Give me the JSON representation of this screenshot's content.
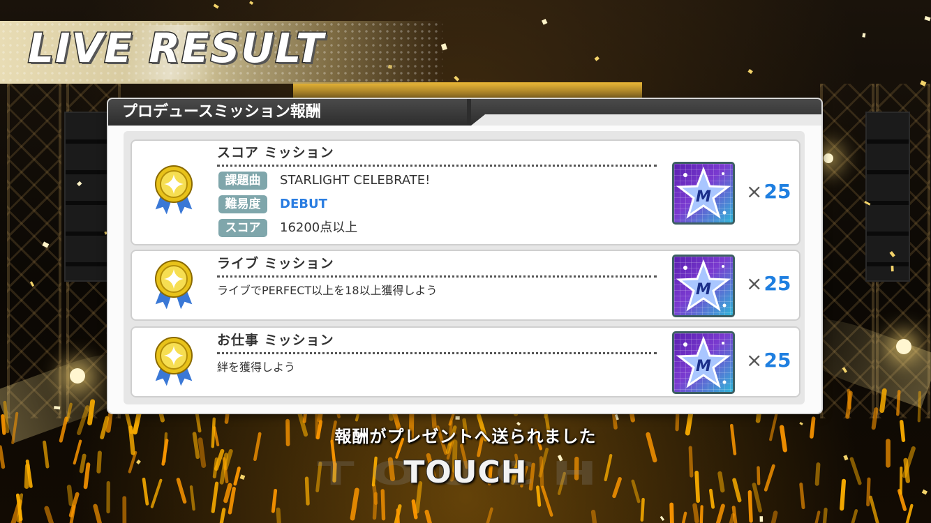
{
  "header": {
    "title": "LIVE RESULT"
  },
  "panel": {
    "title": "プロデュースミッション報酬"
  },
  "missions": [
    {
      "title": "スコア ミッション",
      "details": [
        {
          "tag": "課題曲",
          "value": "STARLIGHT CELEBRATE!"
        },
        {
          "tag": "難易度",
          "value": "DEBUT"
        },
        {
          "tag": "スコア",
          "value": "16200点以上"
        }
      ],
      "reward_icon": "star-m-icon",
      "reward_x": "×",
      "reward_qty": "25"
    },
    {
      "title": "ライブ ミッション",
      "description": "ライブでPERFECT以上を18以上獲得しよう",
      "reward_icon": "star-m-icon",
      "reward_x": "×",
      "reward_qty": "25"
    },
    {
      "title": "お仕事 ミッション",
      "description": "絆を獲得しよう",
      "reward_icon": "star-m-icon",
      "reward_x": "×",
      "reward_qty": "25"
    }
  ],
  "footer": {
    "notice": "報酬がプレゼントへ送られました",
    "touch": "TOUCH"
  },
  "colors": {
    "accent_blue": "#2a7de1",
    "tag_bg": "#7fa6ab",
    "panel_header": "#333333"
  }
}
